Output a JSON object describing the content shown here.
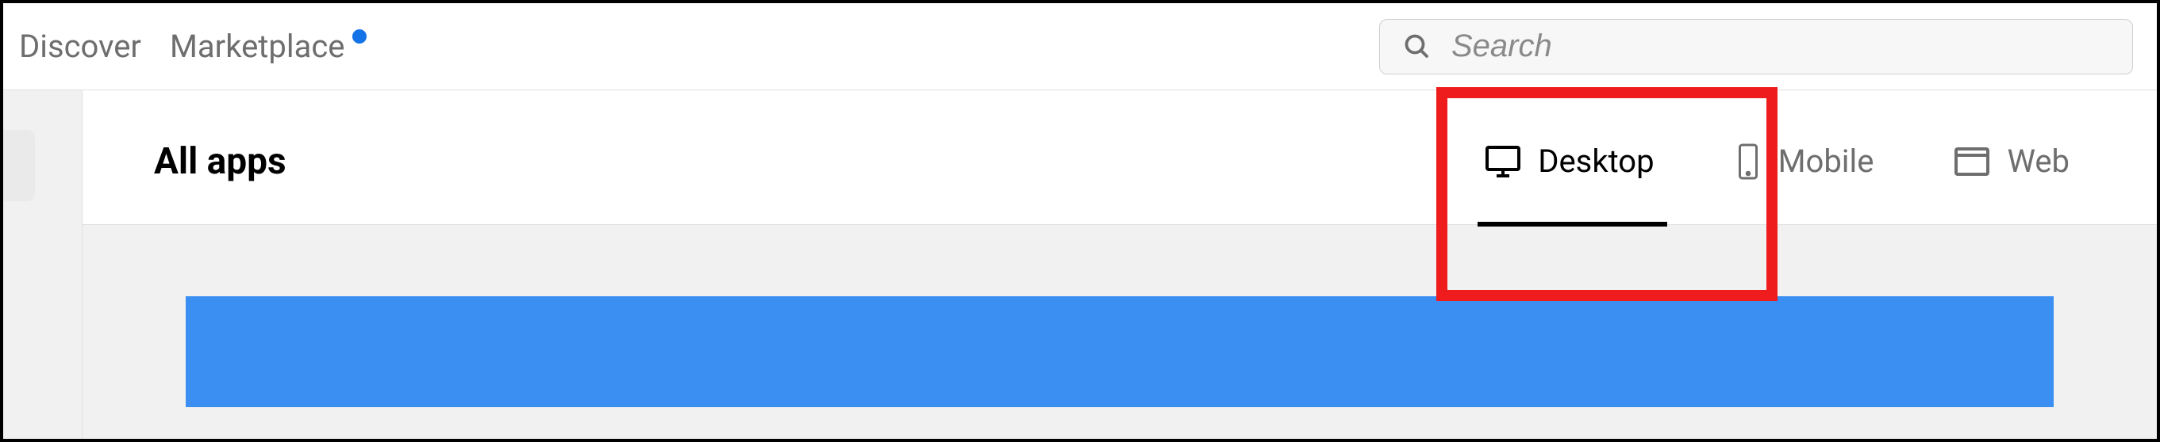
{
  "nav": {
    "discover": "Discover",
    "marketplace": "Marketplace"
  },
  "search": {
    "placeholder": "Search"
  },
  "page": {
    "title": "All apps"
  },
  "tabs": {
    "desktop": "Desktop",
    "mobile": "Mobile",
    "web": "Web"
  },
  "colors": {
    "accent_blue": "#3b8ff3",
    "dot_blue": "#1473e6",
    "highlight_red": "#ee1c1c"
  }
}
